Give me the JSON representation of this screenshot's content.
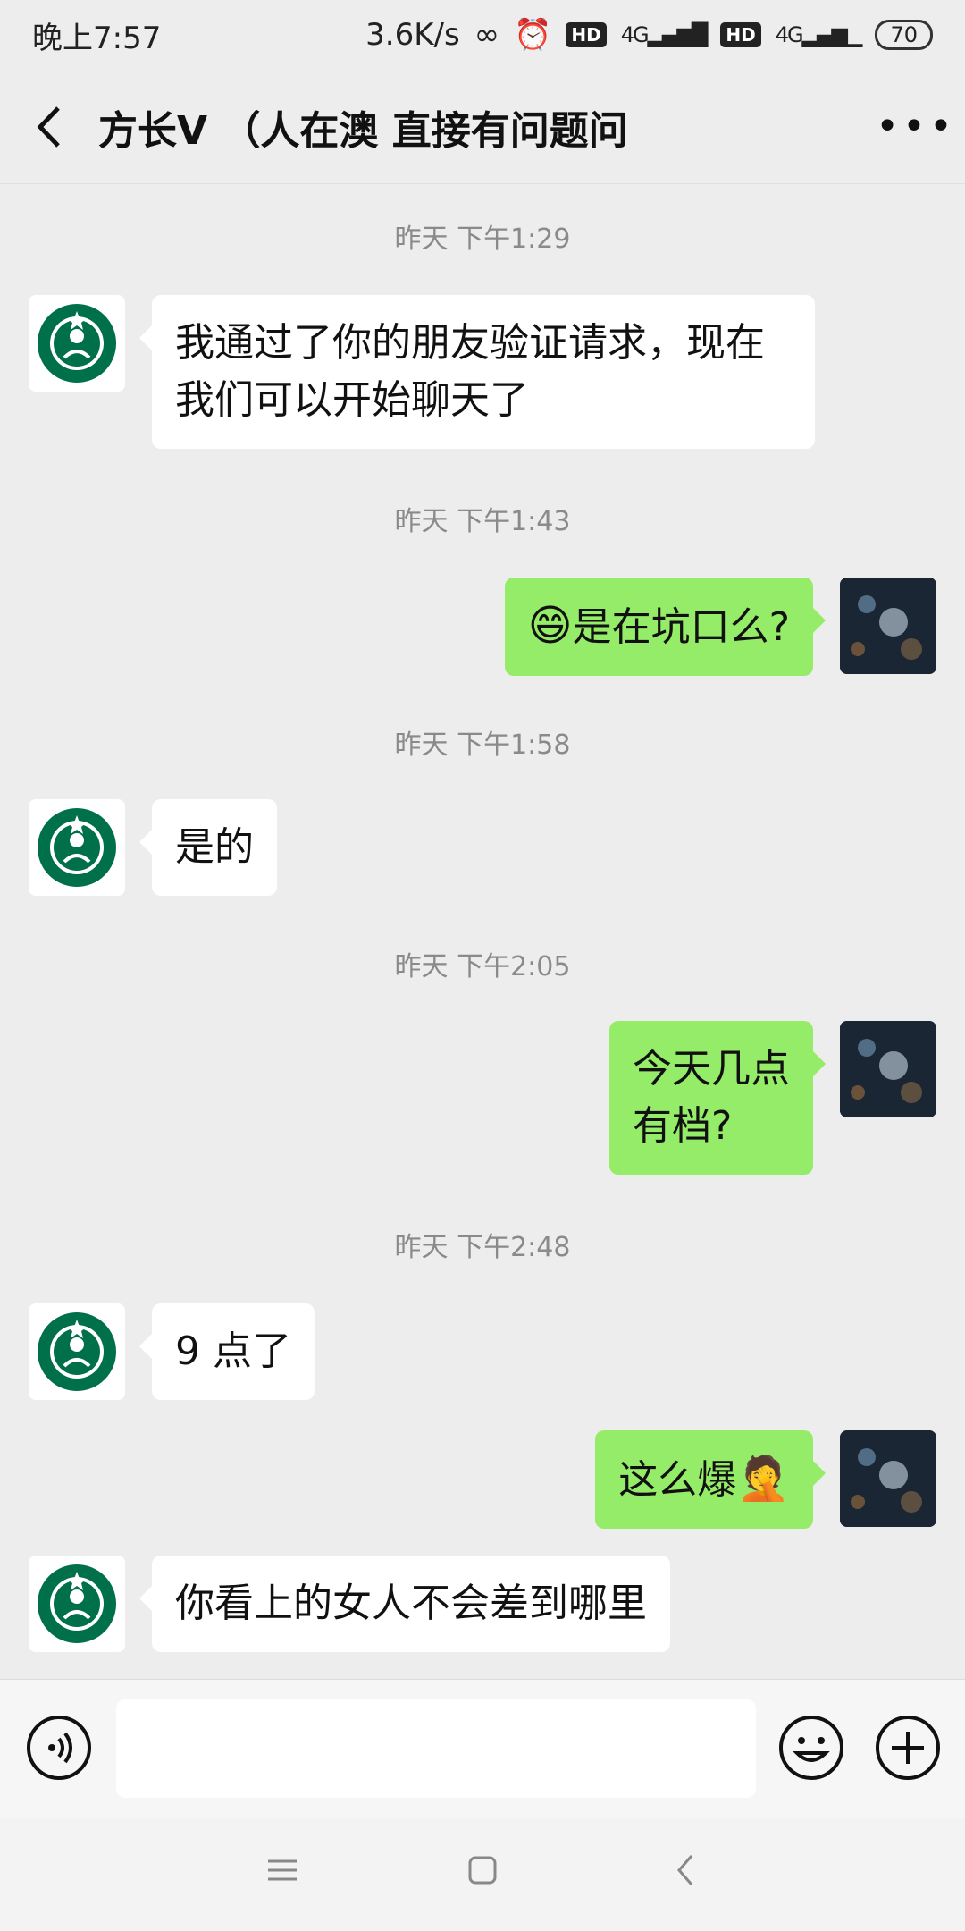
{
  "status_bar": {
    "time": "晚上7:57",
    "speed": "3.6K/s",
    "hd1": "HD",
    "net1": "4G",
    "hd2": "HD",
    "net2": "4G",
    "battery": "70"
  },
  "header": {
    "title": "方长V （人在澳  直接有问题问"
  },
  "messages": [
    {
      "type": "time",
      "text": "昨天 下午1:29"
    },
    {
      "type": "in",
      "text": "我通过了你的朋友验证请求，现在我们可以开始聊天了"
    },
    {
      "type": "time",
      "text": "昨天 下午1:43"
    },
    {
      "type": "out",
      "emoji": "😄",
      "text": "是在坑口么?"
    },
    {
      "type": "time",
      "text": "昨天 下午1:58"
    },
    {
      "type": "in",
      "text": "是的"
    },
    {
      "type": "time",
      "text": "昨天 下午2:05"
    },
    {
      "type": "out",
      "text": "今天几点有档?"
    },
    {
      "type": "time",
      "text": "昨天 下午2:48"
    },
    {
      "type": "in",
      "text": "9 点了"
    },
    {
      "type": "out",
      "text": "这么爆",
      "emoji": "🤦"
    },
    {
      "type": "in",
      "text": "你看上的女人不会差到哪里"
    }
  ],
  "colors": {
    "background": "#ededed",
    "outgoing_bubble": "#95ec69",
    "incoming_bubble": "#ffffff",
    "starbucks_green": "#00704a"
  },
  "icons": {
    "back": "back-arrow-icon",
    "more": "more-dots-icon",
    "voice": "voice-icon",
    "emoji": "emoji-icon",
    "plus": "plus-icon",
    "nav_menu": "menu-icon",
    "nav_home": "home-icon",
    "nav_back": "nav-back-icon"
  }
}
